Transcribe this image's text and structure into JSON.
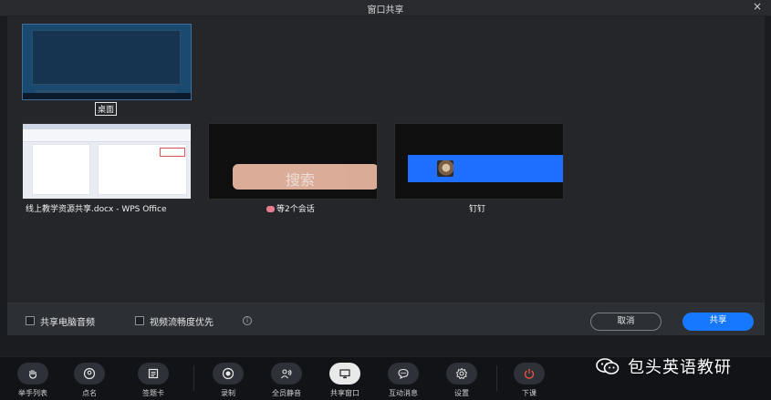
{
  "window": {
    "title": "窗口共享",
    "close_label": "×"
  },
  "sources": [
    {
      "label": "桌面"
    },
    {
      "label": "线上教学资源共享.docx - WPS Office"
    },
    {
      "label": "等2个会话",
      "thumb_text": "搜索"
    },
    {
      "label": "钉钉"
    }
  ],
  "footer": {
    "share_audio_label": "共享电脑音频",
    "video_priority_label": "视频流畅度优先",
    "cancel_label": "取消",
    "share_label": "共享"
  },
  "toolbar": {
    "items": [
      {
        "label": "举手列表",
        "icon": "hand-icon"
      },
      {
        "label": "点名",
        "icon": "roll-call-icon"
      },
      {
        "label": "签题卡",
        "icon": "card-icon"
      },
      {
        "label": "录制",
        "icon": "record-icon"
      },
      {
        "label": "全员静音",
        "icon": "mute-all-icon"
      },
      {
        "label": "共享窗口",
        "icon": "share-screen-icon"
      },
      {
        "label": "互动消息",
        "icon": "chat-icon"
      },
      {
        "label": "设置",
        "icon": "gear-icon"
      },
      {
        "label": "下课",
        "icon": "power-icon"
      }
    ]
  },
  "watermark": {
    "text": "包头英语教研"
  },
  "colors": {
    "accent": "#1677ff",
    "end_class": "#e9553f"
  }
}
